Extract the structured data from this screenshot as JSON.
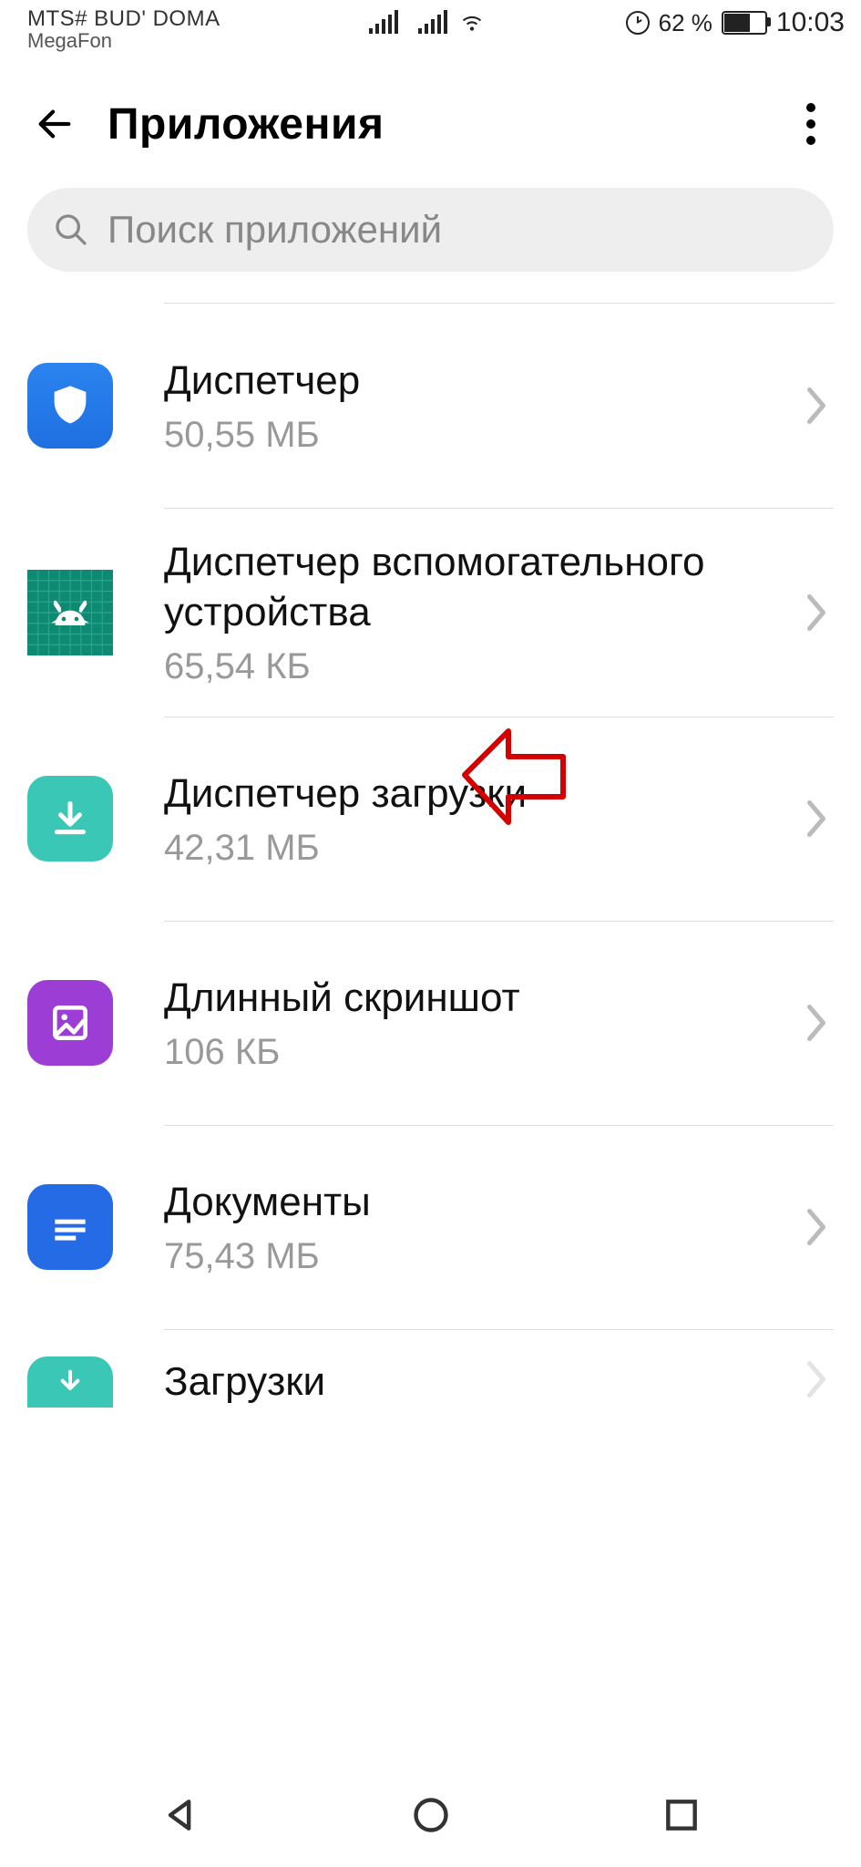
{
  "statusBar": {
    "carrier1": "MTS# BUD' DOMA",
    "carrier2": "MegaFon",
    "batteryPercent": "62 %",
    "time": "10:03"
  },
  "header": {
    "title": "Приложения"
  },
  "search": {
    "placeholder": "Поиск приложений"
  },
  "apps": [
    {
      "name": "Диспетчер",
      "size": "50,55 МБ",
      "icon": "shield"
    },
    {
      "name": "Диспетчер вспомогательного устройства",
      "size": "65,54 КБ",
      "icon": "android"
    },
    {
      "name": "Диспетчер загрузки",
      "size": "42,31 МБ",
      "icon": "download",
      "highlighted": true
    },
    {
      "name": "Длинный скриншот",
      "size": "106 КБ",
      "icon": "screenshot"
    },
    {
      "name": "Документы",
      "size": "75,43 МБ",
      "icon": "docs"
    },
    {
      "name": "Загрузки",
      "size": "",
      "icon": "downloads2"
    }
  ]
}
